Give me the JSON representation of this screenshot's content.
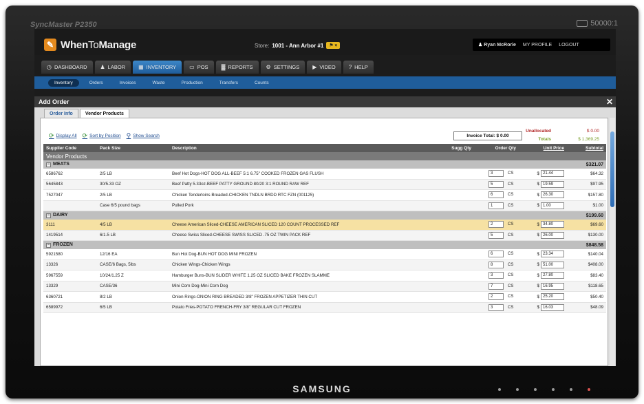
{
  "monitor": {
    "model_label": "SyncMaster P2350",
    "resolution_label": "50000:1",
    "brand": "SAMSUNG"
  },
  "app": {
    "logo_when": "When",
    "logo_to": "To",
    "logo_manage": "Manage",
    "store_label": "Store:",
    "store_value": "1001 - Ann Arbor #1",
    "store_btn": "⚑ ▾",
    "user": "Ryan McRorie",
    "my_profile": "MY PROFILE",
    "logout": "LOGOUT"
  },
  "nav": {
    "tabs": [
      {
        "label": "DASHBOARD",
        "icon": "◷"
      },
      {
        "label": "LABOR",
        "icon": "♟"
      },
      {
        "label": "INVENTORY",
        "icon": "▦"
      },
      {
        "label": "POS",
        "icon": "▭"
      },
      {
        "label": "REPORTS",
        "icon": "▓"
      },
      {
        "label": "SETTINGS",
        "icon": "⚙"
      },
      {
        "label": "VIDEO",
        "icon": "▶"
      },
      {
        "label": "HELP",
        "icon": "?"
      }
    ],
    "sub": [
      "Inventory",
      "Orders",
      "Invoices",
      "Waste",
      "Production",
      "Transfers",
      "Counts"
    ]
  },
  "modal": {
    "title": "Add Order",
    "close": "✕",
    "tabs": [
      "Order Info",
      "Vendor Products"
    ],
    "actions": {
      "display_all": "Display All",
      "sort": "Sort by Position",
      "search": "Show Search"
    },
    "invoice_total": "Invoice Total: $ 0.00",
    "unallocated_label": "Unallocated",
    "unallocated_value": "$ 0.00",
    "totals_label": "Totals",
    "totals_value": "$ 1,369.25"
  },
  "table": {
    "headers": {
      "code": "Supplier Code",
      "pack": "Pack Size",
      "desc": "Description",
      "sugg": "Sugg Qty",
      "order": "Order Qty",
      "price": "Unit Price",
      "sub": "Subtotal"
    },
    "section": "Vendor Products",
    "categories": [
      {
        "name": "MEATS",
        "total": "$321.07",
        "rows": [
          {
            "code": "6586762",
            "pack": "2/5 LB",
            "desc": "Beef Hot Dogs-HOT DOG ALL-BEEF 5:1 6.75\" COOKED FROZEN GAS FLUSH",
            "qty": "3",
            "unit": "CS",
            "price": "21.44",
            "sub": "$64.32"
          },
          {
            "code": "5645843",
            "pack": "30/5.33 OZ",
            "desc": "Beef Patty 5.33oz-BEEF PATTY GROUND 80/20 3:1 ROUND RAW REF",
            "qty": "5",
            "unit": "CS",
            "price": "19.59",
            "sub": "$97.95"
          },
          {
            "code": "7527047",
            "pack": "2/5 LB",
            "desc": "Chicken Tenderloins Breaded-CHICKEN TNDLN BRDD RTC FZN (001125)",
            "qty": "6",
            "unit": "CS",
            "price": "26.30",
            "sub": "$157.80"
          },
          {
            "code": "",
            "pack": "Case 6/5 pound bags",
            "desc": "Pulled Pork",
            "qty": "1",
            "unit": "CS",
            "price": "1.00",
            "sub": "$1.00"
          }
        ]
      },
      {
        "name": "DAIRY",
        "total": "$199.60",
        "rows": [
          {
            "code": "3111",
            "pack": "4/5 LB",
            "desc": "Cheese American Sliced-CHEESE AMERICAN SLICED 120 COUNT PROCESSED REF",
            "qty": "2",
            "unit": "CS",
            "price": "34.80",
            "sub": "$69.60"
          },
          {
            "code": "1419514",
            "pack": "6/1.5 LB",
            "desc": "Cheese Swiss Sliced-CHEESE SWISS SLICED .75 OZ TWIN PACK REF",
            "qty": "5",
            "unit": "CS",
            "price": "26.00",
            "sub": "$130.00"
          }
        ]
      },
      {
        "name": "FROZEN",
        "total": "$848.58",
        "rows": [
          {
            "code": "5921580",
            "pack": "12/16 EA",
            "desc": "Bun Hot Dog-BUN HOT DOG MINI FROZEN",
            "qty": "6",
            "unit": "CS",
            "price": "23.34",
            "sub": "$140.04"
          },
          {
            "code": "13326",
            "pack": "CASE/6 Bags, 5lbs",
            "desc": "Chicken Wings-Chicken Wings",
            "qty": "8",
            "unit": "CS",
            "price": "51.00",
            "sub": "$408.00"
          },
          {
            "code": "5967559",
            "pack": "10/24/1.25 Z",
            "desc": "Hamburger Buns-BUN SLIDER WHITE 1.25 OZ SLICED BAKE FROZEN SLAMME",
            "qty": "3",
            "unit": "CS",
            "price": "27.80",
            "sub": "$83.40"
          },
          {
            "code": "13329",
            "pack": "CASE/36",
            "desc": "Mini Corn Dog-Mini Corn Dog",
            "qty": "7",
            "unit": "CS",
            "price": "16.95",
            "sub": "$118.65"
          },
          {
            "code": "6360721",
            "pack": "8/2 LB",
            "desc": "Onion Rings-ONION RING BREADED 3/8\" FROZEN APPETIZER THIN CUT",
            "qty": "2",
            "unit": "CS",
            "price": "25.20",
            "sub": "$50.40"
          },
          {
            "code": "6589972",
            "pack": "6/5 LB",
            "desc": "Potato Fries-POTATO FRENCH-FRY 3/8\" REGULAR CUT FROZEN",
            "qty": "3",
            "unit": "CS",
            "price": "16.03",
            "sub": "$48.09"
          }
        ]
      }
    ]
  }
}
